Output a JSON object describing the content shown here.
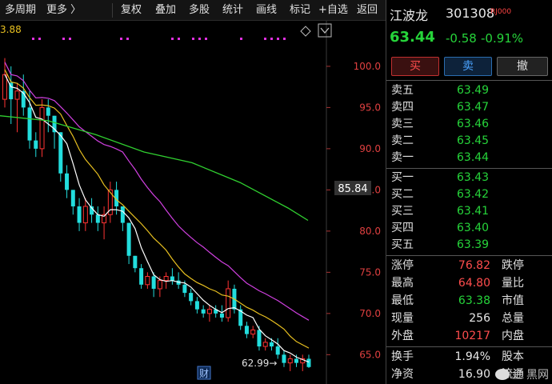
{
  "toolbar": {
    "items": [
      "多周期",
      "更多 〉",
      "复权",
      "叠加",
      "多股",
      "统计",
      "画线",
      "标记",
      "+自选",
      "返回"
    ]
  },
  "chart": {
    "top_left_value": "3.88",
    "last_price_tag": "85.84",
    "min_label": "62.99→",
    "finance_badge": "财",
    "colors": {
      "up": "#ff3333",
      "down": "#22dddd",
      "ma5": "#ffffff",
      "ma10": "#e8c020",
      "ma20": "#d040e0",
      "ma60": "#30d030",
      "price_tag_bg": "#333333"
    }
  },
  "chart_data": {
    "type": "candlestick",
    "yticks": [
      100.0,
      95.0,
      90.0,
      85.0,
      80.0,
      75.0,
      70.0,
      65.0
    ],
    "ylim": [
      62.8,
      103.0
    ],
    "candles": [
      [
        96,
        101,
        95,
        99
      ],
      [
        98,
        100,
        93,
        96
      ],
      [
        96,
        98,
        92,
        97
      ],
      [
        97,
        99,
        94,
        95
      ],
      [
        95,
        97,
        90,
        91
      ],
      [
        91,
        92,
        89,
        90
      ],
      [
        90,
        96,
        89,
        95
      ],
      [
        95,
        96,
        92,
        94
      ],
      [
        94,
        94,
        90,
        92
      ],
      [
        92,
        92,
        86,
        87
      ],
      [
        87,
        88,
        84,
        85
      ],
      [
        85,
        85,
        82,
        83
      ],
      [
        83,
        84,
        80,
        81
      ],
      [
        81,
        84,
        80,
        83
      ],
      [
        83,
        84,
        81,
        82
      ],
      [
        82,
        83,
        80,
        81
      ],
      [
        81,
        83,
        79,
        82
      ],
      [
        82,
        86,
        81,
        85
      ],
      [
        85,
        86,
        82,
        83
      ],
      [
        83,
        83,
        80,
        81
      ],
      [
        81,
        81,
        76,
        77
      ],
      [
        77,
        77,
        75,
        75.5
      ],
      [
        75.5,
        76,
        73,
        73.5
      ],
      [
        73.5,
        75,
        73,
        74.5
      ],
      [
        74.5,
        75,
        72,
        73
      ],
      [
        73,
        74.5,
        72,
        74
      ],
      [
        74,
        75,
        73,
        74.5
      ],
      [
        74.5,
        75.5,
        73.5,
        74
      ],
      [
        74,
        75,
        73,
        73.5
      ],
      [
        73.5,
        74,
        72,
        72.5
      ],
      [
        72.5,
        73,
        71,
        71.5
      ],
      [
        71.5,
        72,
        70,
        70.5
      ],
      [
        70.5,
        71,
        69.5,
        70
      ],
      [
        70,
        71,
        69,
        70.5
      ],
      [
        70.5,
        71,
        69.5,
        70
      ],
      [
        70,
        71,
        69,
        69.5
      ],
      [
        69.5,
        74,
        69,
        73
      ],
      [
        73,
        73.5,
        70,
        70.5
      ],
      [
        70.5,
        71,
        68,
        68.5
      ],
      [
        68.5,
        69,
        67,
        67.5
      ],
      [
        67.5,
        68.5,
        67,
        68
      ],
      [
        68,
        68.5,
        65.5,
        66
      ],
      [
        66,
        67,
        65.5,
        66.5
      ],
      [
        66.5,
        67,
        65.5,
        66
      ],
      [
        66,
        67,
        64.5,
        65
      ],
      [
        65,
        65.5,
        63.5,
        64
      ],
      [
        64,
        65,
        63,
        64.5
      ],
      [
        64.5,
        65,
        63.5,
        64
      ],
      [
        64,
        65,
        63,
        64.5
      ],
      [
        64.5,
        65,
        63.4,
        63.5
      ]
    ],
    "ma60": [
      [
        0,
        94.0
      ],
      [
        60,
        93.4
      ],
      [
        120,
        91.7
      ],
      [
        180,
        89.6
      ],
      [
        240,
        88.3
      ],
      [
        300,
        85.9
      ],
      [
        360,
        82.8
      ],
      [
        385,
        81.3
      ]
    ]
  },
  "quote": {
    "name": "江波龙",
    "code": "301308",
    "badge": "RJ000",
    "price": "63.44",
    "change": "-0.58",
    "change_pct": "-0.91%"
  },
  "buttons": {
    "buy": "买",
    "sell": "卖",
    "cancel": "撤"
  },
  "orderbook": {
    "asks": [
      {
        "label": "卖五",
        "price": "63.49"
      },
      {
        "label": "卖四",
        "price": "63.47"
      },
      {
        "label": "卖三",
        "price": "63.46"
      },
      {
        "label": "卖二",
        "price": "63.45"
      },
      {
        "label": "卖一",
        "price": "63.44"
      }
    ],
    "bids": [
      {
        "label": "买一",
        "price": "63.43"
      },
      {
        "label": "买二",
        "price": "63.42"
      },
      {
        "label": "买三",
        "price": "63.41"
      },
      {
        "label": "买四",
        "price": "63.40"
      },
      {
        "label": "买五",
        "price": "63.39"
      }
    ]
  },
  "stats": [
    {
      "label": "涨停",
      "value": "76.82",
      "color": "red",
      "label2": "跌停"
    },
    {
      "label": "最高",
      "value": "64.80",
      "color": "red",
      "label2": "量比"
    },
    {
      "label": "最低",
      "value": "63.38",
      "color": "green",
      "label2": "市值"
    },
    {
      "label": "现量",
      "value": "256",
      "color": "white",
      "label2": "总量"
    },
    {
      "label": "外盘",
      "value": "10217",
      "color": "red",
      "label2": "内盘"
    },
    {
      "label": "换手",
      "value": "1.94%",
      "color": "white",
      "label2": "股本"
    },
    {
      "label": "净资",
      "value": "16.90",
      "color": "white",
      "label2": "流通"
    }
  ],
  "watermark": "金 黑网"
}
